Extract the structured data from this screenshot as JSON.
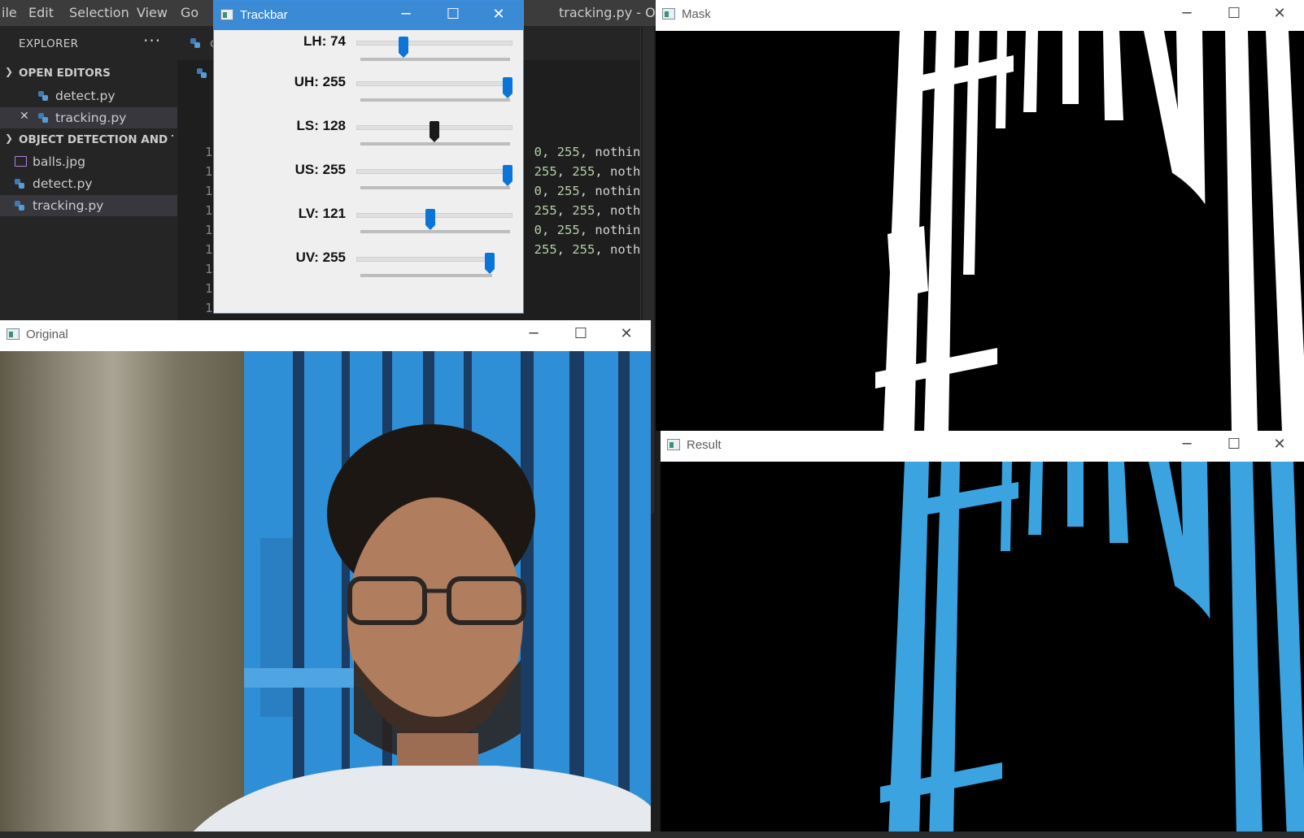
{
  "vscode": {
    "menu": [
      "ile",
      "Edit",
      "Selection",
      "View",
      "Go"
    ],
    "window_title": "tracking.py - Obje",
    "explorer_label": "EXPLORER",
    "more_icon": "ellipsis-icon",
    "open_editors_label": "OPEN EDITORS",
    "open_editors": [
      "detect.py",
      "tracking.py"
    ],
    "project_label": "OBJECT DETECTION AND T...",
    "files": [
      "balls.jpg",
      "detect.py",
      "tracking.py"
    ],
    "tab_text": "c",
    "line_numbers": [
      "1",
      "1",
      "1",
      "1",
      "1",
      "1",
      "1",
      "1",
      "1"
    ],
    "code_lines": [
      {
        "n1": "0",
        "n2": "255",
        "tail": "nothing"
      },
      {
        "n1": "255",
        "n2": "255",
        "tail": "nothi"
      },
      {
        "n1": "0",
        "n2": "255",
        "tail": "nothing"
      },
      {
        "n1": "255",
        "n2": "255",
        "tail": "nothi"
      },
      {
        "n1": "0",
        "n2": "255",
        "tail": "nothing"
      },
      {
        "n1": "255",
        "n2": "255",
        "tail": "nothi"
      }
    ]
  },
  "trackbar": {
    "title": "Trackbar",
    "bars": [
      {
        "label": "LH: 74",
        "value": 74,
        "max": 255
      },
      {
        "label": "UH: 255",
        "value": 255,
        "max": 255
      },
      {
        "label": "LS: 128",
        "value": 128,
        "max": 255
      },
      {
        "label": "US: 255",
        "value": 255,
        "max": 255
      },
      {
        "label": "LV: 121",
        "value": 121,
        "max": 255
      },
      {
        "label": "UV: 255",
        "value": 255,
        "max": 255
      }
    ]
  },
  "windows": {
    "original": "Original",
    "mask": "Mask",
    "result": "Result"
  },
  "colors": {
    "vscode_bg": "#1e1e1e",
    "trackbar_titlebar": "#3a8ad6",
    "slider_thumb": "#0a74d8",
    "gate_blue": "#2f8fd6",
    "result_blue": "#3aa3e0"
  }
}
